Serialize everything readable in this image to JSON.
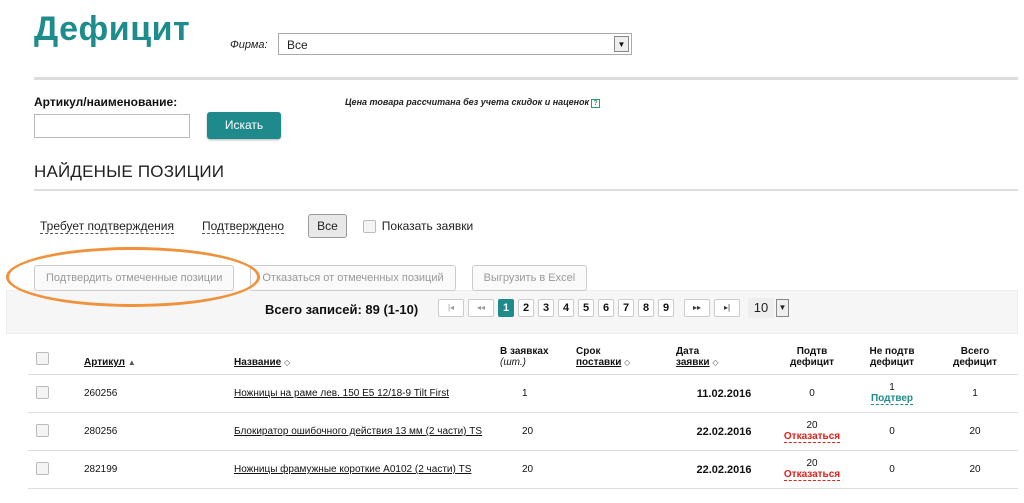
{
  "header": {
    "title": "Дефицит",
    "firm_label": "Фирма:",
    "firm_value": "Все"
  },
  "search": {
    "label": "Артикул/наименование:",
    "button": "Искать",
    "price_note": "Цена товара рассчитана без учета скидок и наценок",
    "help_icon": "?"
  },
  "found": {
    "title": "НАЙДЕНЫЕ ПОЗИЦИИ"
  },
  "filters": {
    "requires_confirmation": "Требует подтверждения",
    "confirmed": "Подтверждено",
    "all": "Все",
    "show_orders": "Показать заявки"
  },
  "actions": {
    "confirm_selected": "Подтвердить отмеченные позиции",
    "reject_selected": "Отказаться от отмеченных позиций",
    "export_excel": "Выгрузить в Excel"
  },
  "pager": {
    "total": "Всего записей: 89 (1-10)",
    "pages": [
      "1",
      "2",
      "3",
      "4",
      "5",
      "6",
      "7",
      "8",
      "9"
    ],
    "active_page": "1",
    "first": "|◂",
    "prev": "◂◂",
    "next": "▸▸",
    "last": "▸|",
    "page_size": "10"
  },
  "table": {
    "headers": {
      "article": "Артикул",
      "name": "Название",
      "in_orders_1": "В заявках",
      "in_orders_2": "(шт.)",
      "delivery_1": "Срок",
      "delivery_2": "поставки",
      "order_date_1": "Дата",
      "order_date_2": "заявки",
      "confirmed_deficit_1": "Подтв",
      "confirmed_deficit_2": "дефицит",
      "unconfirmed_deficit_1": "Не подтв",
      "unconfirmed_deficit_2": "дефицит",
      "total_deficit_1": "Всего",
      "total_deficit_2": "дефицит"
    },
    "rows": [
      {
        "article": "260256",
        "name": "Ножницы на раме лев. 150 Е5 12/18-9 Tilt First",
        "in_orders": "1",
        "delivery": "",
        "order_date": "11.02.2016",
        "confirmed_top": "0",
        "confirmed_link": "",
        "unconfirmed_top": "1",
        "unconfirmed_link": "Подтвер",
        "total": "1"
      },
      {
        "article": "280256",
        "name": "Блокиратор ошибочного действия 13 мм (2 части) TS",
        "in_orders": "20",
        "delivery": "",
        "order_date": "22.02.2016",
        "confirmed_top": "20",
        "confirmed_link": "Отказаться",
        "unconfirmed_top": "0",
        "unconfirmed_link": "",
        "total": "20"
      },
      {
        "article": "282199",
        "name": "Ножницы фрамужные короткие А0102 (2 части) TS",
        "in_orders": "20",
        "delivery": "",
        "order_date": "22.02.2016",
        "confirmed_top": "20",
        "confirmed_link": "Отказаться",
        "unconfirmed_top": "0",
        "unconfirmed_link": "",
        "total": "20"
      }
    ]
  },
  "colors": {
    "accent": "#1f8a8c",
    "highlight_circle": "#f0913c",
    "danger": "#e0201a"
  }
}
